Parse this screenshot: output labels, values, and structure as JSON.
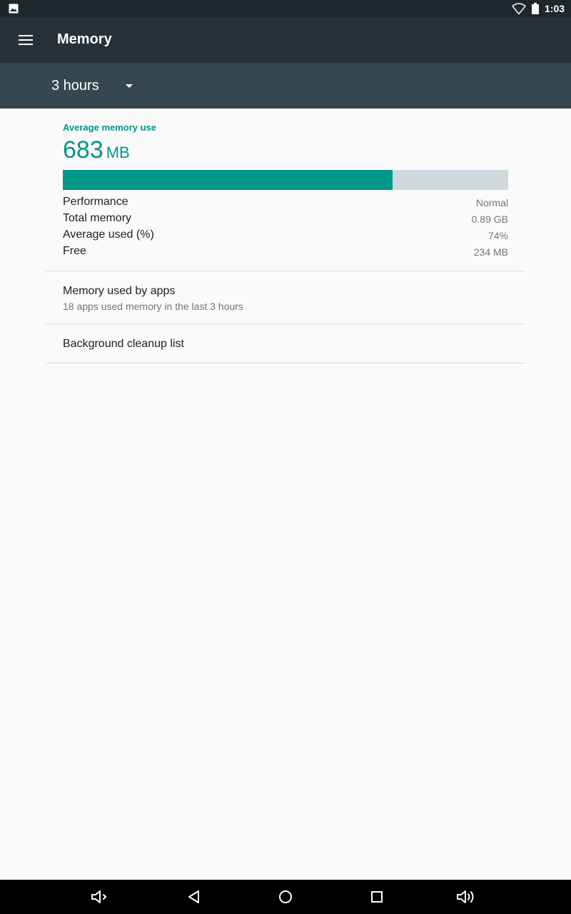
{
  "status_bar": {
    "time": "1:03",
    "icons": [
      "image-notification-icon",
      "wifi-icon",
      "battery-icon"
    ]
  },
  "app_bar": {
    "menu_icon": "menu-icon",
    "title": "Memory"
  },
  "filter": {
    "selected": "3 hours",
    "arrow_icon": "dropdown-arrow-icon"
  },
  "summary": {
    "label": "Average memory use",
    "value": "683",
    "unit": "MB",
    "usage_fraction": 0.74,
    "colors": {
      "accent": "#009688",
      "track": "#cfd8dc"
    }
  },
  "stats": [
    {
      "label": "Performance",
      "value": "Normal"
    },
    {
      "label": "Total memory",
      "value": "0.89 GB"
    },
    {
      "label": "Average used (%)",
      "value": "74%"
    },
    {
      "label": "Free",
      "value": "234 MB"
    }
  ],
  "list": {
    "apps": {
      "title": "Memory used by apps",
      "subtitle": "18 apps used memory in the last 3 hours"
    },
    "cleanup": {
      "title": "Background cleanup list"
    }
  },
  "nav_bar": {
    "icons": [
      "volume-down-icon",
      "back-icon",
      "home-icon",
      "recents-icon",
      "volume-up-icon"
    ]
  }
}
